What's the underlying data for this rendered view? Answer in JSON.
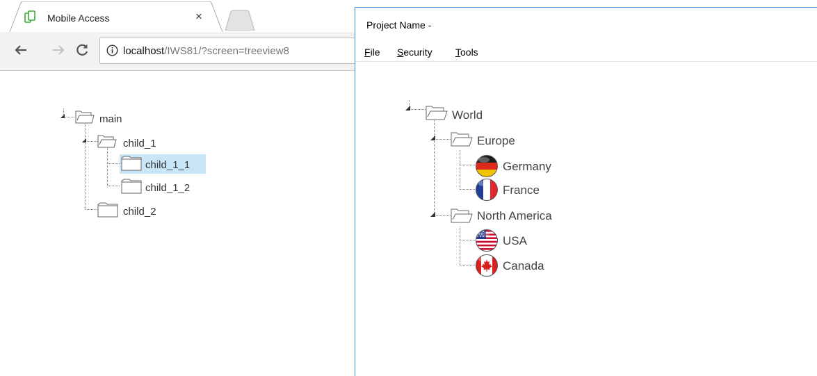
{
  "browser": {
    "tab": {
      "title": "Mobile Access",
      "close_label": "×"
    },
    "address": {
      "host": "localhost",
      "path": "/IWS81/?screen=treeview8"
    }
  },
  "page_tree": {
    "root": "main",
    "child_1": "child_1",
    "child_1_1": "child_1_1",
    "child_1_2": "child_1_2",
    "child_2": "child_2",
    "selected": "child_1_1"
  },
  "window": {
    "title": "Project Name -",
    "menu": [
      {
        "mnemonic": "F",
        "rest": "ile"
      },
      {
        "mnemonic": "S",
        "rest": "ecurity"
      },
      {
        "mnemonic": "T",
        "rest": "ools"
      }
    ],
    "tree": {
      "root": "World",
      "europe": "Europe",
      "germany": "Germany",
      "france": "France",
      "north_america": "North America",
      "usa": "USA",
      "canada": "Canada"
    }
  },
  "colors": {
    "window_border": "#3c8fd9",
    "selection": "#c9e6f7",
    "tab_icon": "#3aaa35"
  }
}
